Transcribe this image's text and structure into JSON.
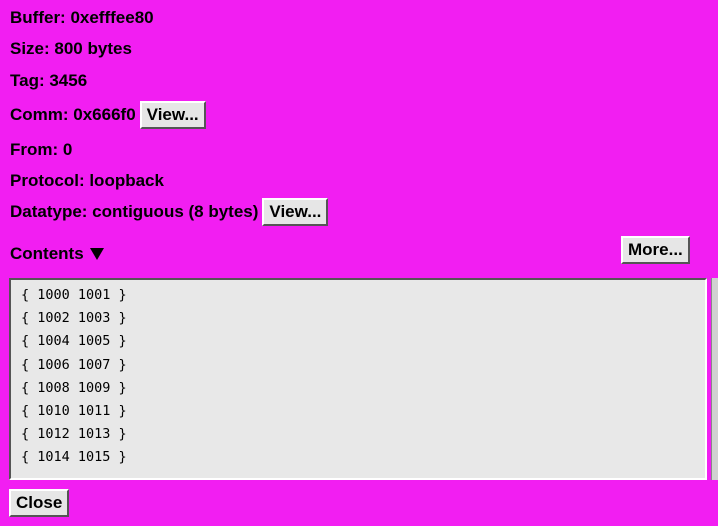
{
  "fields": {
    "buffer": "Buffer: 0xefffee80",
    "size": "Size: 800 bytes",
    "tag": "Tag: 3456",
    "comm": "Comm: 0x666f0",
    "from": "From: 0",
    "protocol": "Protocol: loopback",
    "datatype": "Datatype: contiguous (8 bytes)"
  },
  "buttons": {
    "comm_view": "View...",
    "datatype_view": "View...",
    "more": "More...",
    "close": "Close"
  },
  "contents": {
    "label": "Contents",
    "icon": "triangle-down-icon",
    "rows": [
      "{ 1000 1001 }",
      "{ 1002 1003 }",
      "{ 1004 1005 }",
      "{ 1006 1007 }",
      "{ 1008 1009 }",
      "{ 1010 1011 }",
      "{ 1012 1013 }",
      "{ 1014 1015 }"
    ]
  },
  "colors": {
    "background": "#f21ef2",
    "button_face": "#e6e6e6",
    "contents_bg": "#e8e8e8"
  }
}
